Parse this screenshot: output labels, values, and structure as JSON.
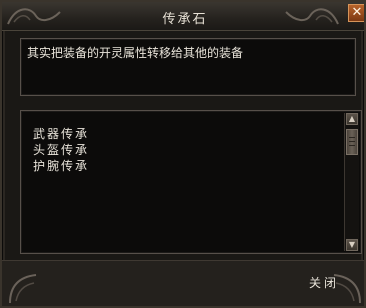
{
  "window": {
    "title": "传承石",
    "close_icon": "close-icon"
  },
  "description": {
    "text": "其实把装备的开灵属性转移给其他的装备"
  },
  "list": {
    "items": [
      {
        "label": "武器传承"
      },
      {
        "label": "头盔传承"
      },
      {
        "label": "护腕传承"
      }
    ]
  },
  "footer": {
    "close_label": "关闭"
  },
  "colors": {
    "text": "#e9e4da",
    "panel_bg": "#0c0b0a",
    "close_button": "#b8632a"
  }
}
